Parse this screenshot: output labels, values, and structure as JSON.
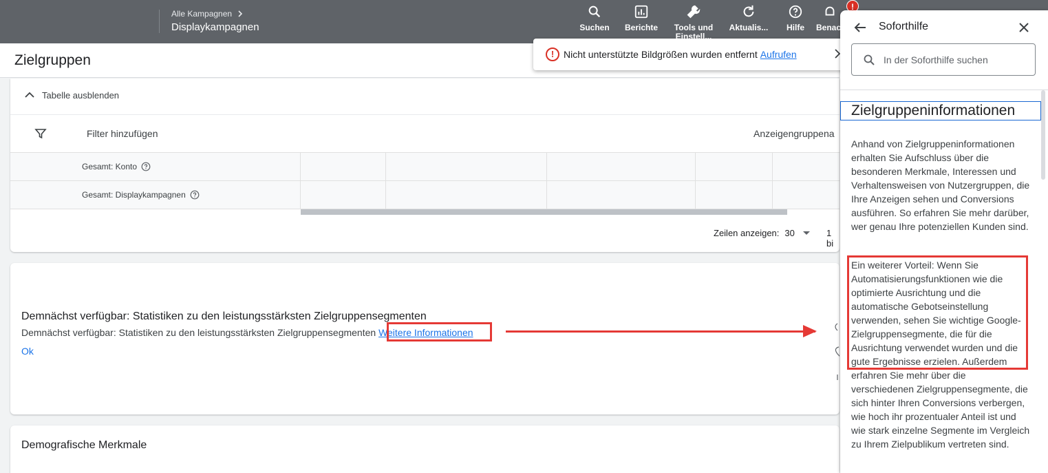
{
  "topbar": {
    "breadcrumb": "Alle Kampagnen",
    "campaign": "Displaykampagnen",
    "nav": [
      {
        "label": "Suchen",
        "icon": "search-icon"
      },
      {
        "label": "Berichte",
        "icon": "reports-icon"
      },
      {
        "label": "Tools und Einstell...",
        "icon": "tools-icon"
      },
      {
        "label": "Aktualis...",
        "icon": "refresh-icon"
      },
      {
        "label": "Hilfe",
        "icon": "help-icon"
      },
      {
        "label": "Benac...",
        "icon": "notifications-icon"
      }
    ],
    "badge": "!"
  },
  "page": {
    "title": "Zielgruppen"
  },
  "toast": {
    "message": "Nicht unterstützte Bildgrößen wurden entfernt",
    "link": "Aufrufen"
  },
  "table_card": {
    "hide_label": "Tabelle ausblenden",
    "filter_label": "Filter hinzufügen",
    "adgroup_label": "Anzeigengruppena",
    "rows": [
      {
        "label": "Gesamt: Konto"
      },
      {
        "label": "Gesamt: Displaykampagnen"
      }
    ],
    "rows_label": "Zeilen anzeigen:",
    "rows_value": "30",
    "range": "1 bi"
  },
  "coming_card": {
    "title": "Demnächst verfügbar: Statistiken zu den leistungsstärksten Zielgruppensegmenten",
    "subtitle": "Demnächst verfügbar: Statistiken zu den leistungsstärksten Zielgruppensegmenten",
    "link": "Weitere Informationen",
    "ok": "Ok"
  },
  "demo_card": {
    "title": "Demografische Merkmale"
  },
  "help_panel": {
    "title": "Soforthilfe",
    "search_placeholder": "In der Soforthilfe suchen",
    "heading": "Zielgruppeninformationen",
    "paragraph1": "Anhand von Zielgruppeninformationen erhalten Sie Aufschluss über die besonderen Merkmale, Interessen und Verhaltensweisen von Nutzergruppen, die Ihre Anzeigen sehen und Conversions ausführen. So erfahren Sie mehr darüber, wer genau Ihre potenziellen Kunden sind.",
    "paragraph2": "Ein weiterer Vorteil: Wenn Sie Automatisierungsfunktionen wie die optimierte Ausrichtung und die automatische Gebotseinstellung verwenden, sehen Sie wichtige Google-Zielgruppensegmente, die für die Ausrichtung verwendet wurden und die gute Ergebnisse erzielen. Außerdem erfahren Sie mehr über die verschiedenen Zielgruppensegmente, die sich hinter Ihren Conversions verbergen, wie hoch ihr prozentualer Anteil ist und wie stark einzelne Segmente im Vergleich zu Ihrem Zielpublikum vertreten sind."
  },
  "colors": {
    "topbar": "#5f6368",
    "link": "#1a73e8",
    "annotation": "#e53935",
    "error": "#d93025"
  }
}
